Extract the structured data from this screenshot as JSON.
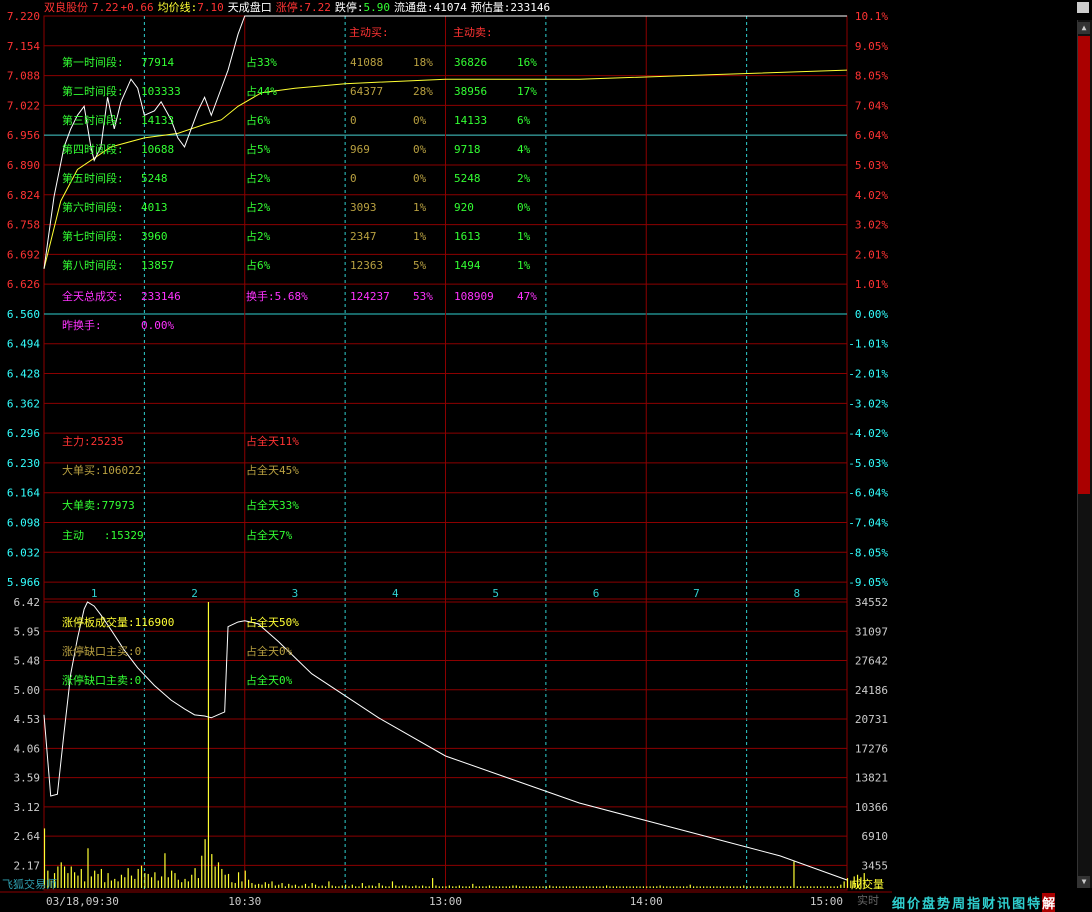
{
  "header": {
    "name": "双良股份",
    "price": "7.22",
    "change": "+0.66",
    "avg_label": "均价线:",
    "avg_value": "7.10",
    "tiancheng": "天成盘口",
    "limit_up_label": "涨停:",
    "limit_up_value": "7.22",
    "limit_down_label": "跌停:",
    "limit_down_value": "5.90",
    "float_label": "流通盘:",
    "float_value": "41074",
    "est_label": "预估量:",
    "est_value": "233146"
  },
  "columns": {
    "active_buy": "主动买:",
    "active_sell": "主动卖:"
  },
  "periods": [
    {
      "label": "第一时间段:",
      "vol": "77914",
      "pct": "占33%",
      "buy": "41088",
      "buy_pct": "18%",
      "sell": "36826",
      "sell_pct": "16%"
    },
    {
      "label": "第二时间段:",
      "vol": "103333",
      "pct": "占44%",
      "buy": "64377",
      "buy_pct": "28%",
      "sell": "38956",
      "sell_pct": "17%"
    },
    {
      "label": "第三时间段:",
      "vol": "14133",
      "pct": "占6%",
      "buy": "0",
      "buy_pct": "0%",
      "sell": "14133",
      "sell_pct": "6%"
    },
    {
      "label": "第四时间段:",
      "vol": "10688",
      "pct": "占5%",
      "buy": "969",
      "buy_pct": "0%",
      "sell": "9718",
      "sell_pct": "4%"
    },
    {
      "label": "第五时间段:",
      "vol": "5248",
      "pct": "占2%",
      "buy": "0",
      "buy_pct": "0%",
      "sell": "5248",
      "sell_pct": "2%"
    },
    {
      "label": "第六时间段:",
      "vol": "4013",
      "pct": "占2%",
      "buy": "3093",
      "buy_pct": "1%",
      "sell": "920",
      "sell_pct": "0%"
    },
    {
      "label": "第七时间段:",
      "vol": "3960",
      "pct": "占2%",
      "buy": "2347",
      "buy_pct": "1%",
      "sell": "1613",
      "sell_pct": "1%"
    },
    {
      "label": "第八时间段:",
      "vol": "13857",
      "pct": "占6%",
      "buy": "12363",
      "buy_pct": "5%",
      "sell": "1494",
      "sell_pct": "1%"
    }
  ],
  "total": {
    "label": "全天总成交:",
    "vol": "233146",
    "turnover": "换手:5.68%",
    "buy": "124237",
    "buy_pct": "53%",
    "sell": "108909",
    "sell_pct": "47%"
  },
  "prev_turnover": {
    "label": "昨换手:",
    "value": "0.00%"
  },
  "main_force": {
    "label": "主力:",
    "value": "25235",
    "pct": "占全天11%"
  },
  "big_buy": {
    "label": "大单买:",
    "value": "106022",
    "pct": "占全天45%"
  },
  "big_sell": {
    "label": "大单卖:",
    "value": "77973",
    "pct": "占全天33%"
  },
  "active": {
    "label": "主动",
    "value": ":15329",
    "pct": "占全天7%"
  },
  "limit_vol": {
    "label": "涨停板成交量:",
    "value": "116900",
    "pct": "占全天50%"
  },
  "gap_buy": {
    "label": "涨停缺口主买:",
    "value": "0",
    "pct": "占全天0%"
  },
  "gap_sell": {
    "label": "涨停缺口主卖:",
    "value": "0",
    "pct": "占全天0%"
  },
  "watermark": "飞狐交易师",
  "volume_label": "成交量",
  "realtime_label": "实时",
  "tabs": [
    "细",
    "价",
    "盘",
    "势",
    "周",
    "指",
    "财",
    "讯",
    "图",
    "特",
    "解"
  ],
  "colors": {
    "up": "#ff3333",
    "down": "#33ff33",
    "neutral": "#33ffff",
    "price_line": "#ffffff",
    "avg_line": "#ffff33",
    "grid": "#8b0000",
    "magenta": "#ff33ff"
  },
  "chart_data": {
    "type": "line",
    "title": "",
    "prev_close": 6.56,
    "price_ticks": [
      "7.220",
      "7.154",
      "7.088",
      "7.022",
      "6.956",
      "6.890",
      "6.824",
      "6.758",
      "6.692",
      "6.626",
      "6.560",
      "6.494",
      "6.428",
      "6.362",
      "6.296",
      "6.230",
      "6.164",
      "6.098",
      "6.032",
      "5.966"
    ],
    "pct_ticks": [
      "10.1%",
      "9.05%",
      "8.05%",
      "7.04%",
      "6.04%",
      "5.03%",
      "4.02%",
      "3.02%",
      "2.01%",
      "1.01%",
      "0.00%",
      "-1.01%",
      "-2.01%",
      "-3.02%",
      "-4.02%",
      "-5.03%",
      "-6.04%",
      "-7.04%",
      "-8.05%",
      "-9.05%"
    ],
    "period_labels": [
      "1",
      "2",
      "3",
      "4",
      "5",
      "6",
      "7",
      "8"
    ],
    "time_ticks": [
      "03/18,09:30",
      "10:30",
      "13:00",
      "14:00",
      "15:00"
    ],
    "ylim_price": [
      5.933,
      7.22
    ],
    "price_series": {
      "name": "",
      "values": [
        [
          0,
          6.66
        ],
        [
          3,
          6.82
        ],
        [
          6,
          6.93
        ],
        [
          8,
          6.97
        ],
        [
          10,
          7.0
        ],
        [
          12,
          7.02
        ],
        [
          14,
          6.93
        ],
        [
          15,
          6.9
        ],
        [
          17,
          6.93
        ],
        [
          19,
          7.04
        ],
        [
          21,
          6.97
        ],
        [
          23,
          7.03
        ],
        [
          26,
          7.08
        ],
        [
          28,
          7.06
        ],
        [
          30,
          7.0
        ],
        [
          33,
          7.01
        ],
        [
          35,
          7.03
        ],
        [
          38,
          6.99
        ],
        [
          40,
          6.95
        ],
        [
          42,
          6.93
        ],
        [
          44,
          6.97
        ],
        [
          46,
          7.01
        ],
        [
          48,
          7.04
        ],
        [
          50,
          7.0
        ],
        [
          52,
          7.04
        ],
        [
          55,
          7.1
        ],
        [
          58,
          7.18
        ],
        [
          60,
          7.22
        ],
        [
          240,
          7.22
        ]
      ]
    },
    "avg_series": {
      "name": "",
      "values": [
        [
          0,
          6.66
        ],
        [
          5,
          6.81
        ],
        [
          10,
          6.88
        ],
        [
          20,
          6.93
        ],
        [
          30,
          6.95
        ],
        [
          40,
          6.96
        ],
        [
          48,
          6.98
        ],
        [
          53,
          6.99
        ],
        [
          58,
          7.02
        ],
        [
          65,
          7.05
        ],
        [
          75,
          7.06
        ],
        [
          90,
          7.07
        ],
        [
          120,
          7.08
        ],
        [
          160,
          7.08
        ],
        [
          200,
          7.09
        ],
        [
          240,
          7.1
        ]
      ]
    },
    "ma_vol_ylim": [
      1.69,
      6.42
    ],
    "ma_vol_ticks": [
      "6.42",
      "5.95",
      "5.48",
      "5.00",
      "4.53",
      "4.06",
      "3.59",
      "3.12",
      "2.64",
      "2.17"
    ],
    "vol_ticks": [
      "34552",
      "31097",
      "27642",
      "24186",
      "20731",
      "17276",
      "13821",
      "10366",
      "6910",
      "3455"
    ],
    "vol_ylim": [
      0,
      34552
    ],
    "ma_vol_series": {
      "name": "",
      "values": [
        [
          0,
          4.5
        ],
        [
          2,
          3.12
        ],
        [
          4,
          3.15
        ],
        [
          6,
          4.2
        ],
        [
          8,
          5.2
        ],
        [
          10,
          5.8
        ],
        [
          12,
          6.3
        ],
        [
          13,
          6.42
        ],
        [
          15,
          6.35
        ],
        [
          17,
          6.2
        ],
        [
          20,
          5.95
        ],
        [
          24,
          5.6
        ],
        [
          28,
          5.3
        ],
        [
          33,
          5.0
        ],
        [
          38,
          4.75
        ],
        [
          42,
          4.6
        ],
        [
          45,
          4.5
        ],
        [
          48,
          4.48
        ],
        [
          50,
          4.45
        ],
        [
          52,
          4.5
        ],
        [
          54,
          4.55
        ],
        [
          55,
          6.0
        ],
        [
          58,
          6.08
        ],
        [
          60,
          6.1
        ],
        [
          64,
          6.05
        ],
        [
          70,
          5.75
        ],
        [
          80,
          5.2
        ],
        [
          100,
          4.45
        ],
        [
          120,
          3.8
        ],
        [
          140,
          3.4
        ],
        [
          160,
          3.0
        ],
        [
          180,
          2.7
        ],
        [
          200,
          2.4
        ],
        [
          220,
          2.1
        ],
        [
          240,
          1.69
        ]
      ]
    },
    "volumes": [
      7200,
      2100,
      900,
      1800,
      2600,
      3100,
      2600,
      1800,
      2600,
      1900,
      1500,
      2300,
      800,
      4800,
      1400,
      2100,
      1700,
      2300,
      700,
      1800,
      900,
      1100,
      800,
      1600,
      1300,
      2400,
      1500,
      1100,
      2300,
      2700,
      1800,
      1700,
      1300,
      1900,
      900,
      1400,
      4200,
      1300,
      2100,
      1800,
      1000,
      700,
      1100,
      800,
      1600,
      2400,
      1200,
      3900,
      5900,
      34552,
      4100,
      2600,
      3100,
      2300,
      1600,
      1700,
      700,
      600,
      1900,
      800,
      2100,
      1000,
      600,
      400,
      500,
      400,
      700,
      500,
      800,
      300,
      400,
      600,
      200,
      500,
      300,
      400,
      200,
      300,
      500,
      200,
      600,
      400,
      200,
      300,
      200,
      800,
      300,
      200,
      200,
      300,
      400,
      200,
      400,
      200,
      200,
      600,
      200,
      300,
      300,
      200,
      600,
      300,
      200,
      200,
      800,
      300,
      200,
      300,
      300,
      200,
      200,
      300,
      200,
      300,
      200,
      200,
      1200,
      300,
      200,
      200,
      200,
      300,
      200,
      200,
      300,
      200,
      200,
      200,
      500,
      200,
      200,
      200,
      200,
      300,
      200,
      200,
      200,
      200,
      200,
      200,
      300,
      300,
      200,
      200,
      200,
      200,
      200,
      200,
      200,
      200,
      200,
      300,
      200,
      200,
      200,
      200,
      200,
      200,
      200,
      200,
      200,
      200,
      200,
      200,
      200,
      200,
      200,
      200,
      300,
      200,
      200,
      200,
      200,
      200,
      200,
      200,
      200,
      200,
      200,
      200,
      200,
      200,
      200,
      200,
      300,
      200,
      200,
      200,
      200,
      200,
      200,
      200,
      200,
      400,
      200,
      200,
      200,
      200,
      200,
      200,
      200,
      200,
      200,
      200,
      200,
      200,
      200,
      200,
      200,
      300,
      200,
      200,
      200,
      200,
      200,
      200,
      200,
      200,
      200,
      200,
      200,
      200,
      200,
      200,
      3200,
      200,
      200,
      200,
      200,
      200,
      200,
      200,
      200,
      200,
      200,
      200,
      200,
      200,
      400,
      800,
      1200,
      900,
      1400,
      1600,
      1300,
      1800
    ]
  }
}
